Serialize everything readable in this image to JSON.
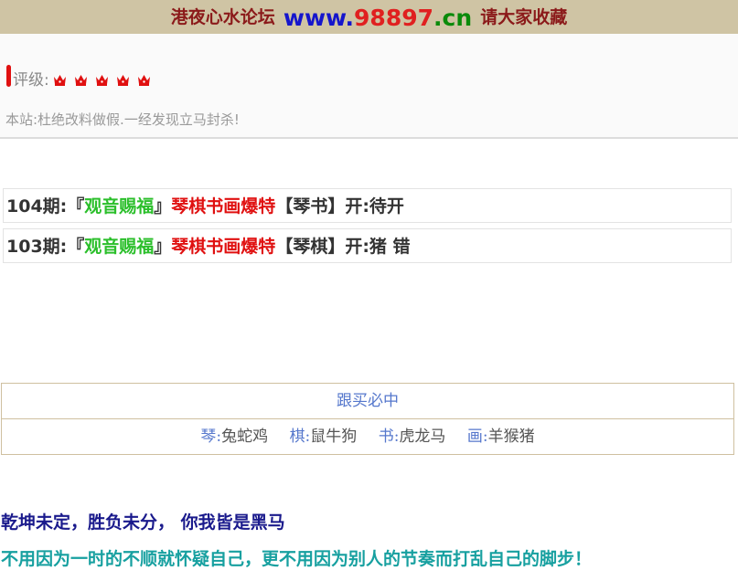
{
  "header": {
    "forum_name": "港夜心水论坛",
    "url_www": "www.",
    "url_number": "98897",
    "url_tld": ".cn",
    "bookmark_text": "请大家收藏",
    "colors": {
      "background": "#cfc4a4",
      "www": "#1515cc",
      "number": "#e02020",
      "tld": "#0a8a0a"
    }
  },
  "info": {
    "rating_label": "评级:",
    "rating_icon": "crown-icon",
    "rating_count": 5,
    "notice": "本站:杜绝改料做假.一经发现立马封杀!"
  },
  "periods": [
    {
      "prefix": "104期:『",
      "green": "观音赐福",
      "close": "』",
      "red": "琴棋书画爆特",
      "tail": "【琴书】开:待开"
    },
    {
      "prefix": "103期:『",
      "green": "观音赐福",
      "close": "』",
      "red": "琴棋书画爆特",
      "tail": "【琴棋】开:猪 错"
    }
  ],
  "tips": {
    "title": "跟买必中",
    "items": [
      {
        "key": "琴:",
        "value": "兔蛇鸡"
      },
      {
        "key": "棋:",
        "value": "鼠牛狗"
      },
      {
        "key": "书:",
        "value": "虎龙马"
      },
      {
        "key": "画:",
        "value": "羊猴猪"
      }
    ]
  },
  "slogans": {
    "line1": "乾坤未定，胜负未分，  你我皆是黑马",
    "line2": "不用因为一时的不顺就怀疑自己，更不用因为别人的节奏而打乱自己的脚步！"
  }
}
